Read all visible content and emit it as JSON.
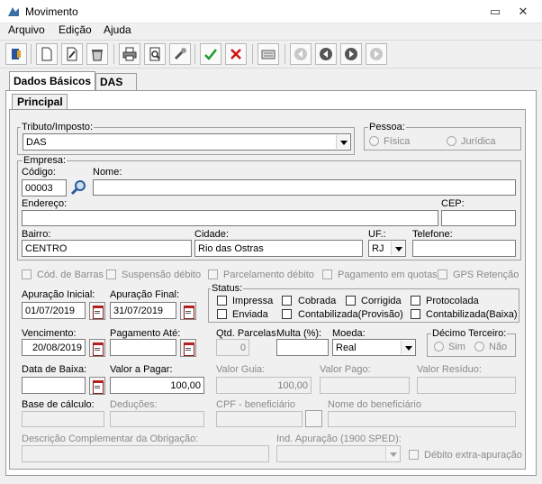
{
  "window": {
    "title": "Movimento"
  },
  "menu": [
    "Arquivo",
    "Edição",
    "Ajuda"
  ],
  "tabs": {
    "outer": [
      "Dados Básicos",
      "DAS"
    ],
    "inner": [
      "Principal"
    ]
  },
  "tributo": {
    "label": "Tributo/Imposto:",
    "value": "DAS"
  },
  "pessoa": {
    "label": "Pessoa:",
    "options": [
      "Física",
      "Jurídica"
    ]
  },
  "empresa": {
    "label": "Empresa:",
    "codigo_label": "Código:",
    "codigo": "00003",
    "nome_label": "Nome:",
    "nome": "",
    "endereco_label": "Endereço:",
    "endereco": "",
    "cep_label": "CEP:",
    "cep": "",
    "bairro_label": "Bairro:",
    "bairro": "CENTRO",
    "cidade_label": "Cidade:",
    "cidade": "Rio das Ostras",
    "uf_label": "UF.:",
    "uf": "RJ",
    "telefone_label": "Telefone:",
    "telefone": ""
  },
  "checks": [
    "Cód. de Barras",
    "Suspensão débito",
    "Parcelamento débito",
    "Pagamento em quotas",
    "GPS Retenção"
  ],
  "apuracao": {
    "inicial_label": "Apuração Inicial:",
    "inicial": "01/07/2019",
    "final_label": "Apuração Final:",
    "final": "31/07/2019"
  },
  "status": {
    "label": "Status:",
    "items": [
      "Impressa",
      "Cobrada",
      "Corrigida",
      "Protocolada",
      "Enviada",
      "Contabilizada(Provisão)",
      "Contabilizada(Baixa)"
    ]
  },
  "vencimento": {
    "label": "Vencimento:",
    "value": "20/08/2019"
  },
  "pagamento_ate": {
    "label": "Pagamento Até:",
    "value": ""
  },
  "qtd_parcelas": {
    "label": "Qtd. Parcelas",
    "value": "0"
  },
  "multa": {
    "label": "Multa (%):",
    "value": ""
  },
  "moeda": {
    "label": "Moeda:",
    "value": "Real"
  },
  "decimo": {
    "label": "Décimo Terceiro:",
    "options": [
      "Sim",
      "Não"
    ]
  },
  "data_baixa": {
    "label": "Data de Baixa:",
    "value": ""
  },
  "valor_pagar": {
    "label": "Valor a Pagar:",
    "value": "100,00"
  },
  "valor_guia": {
    "label": "Valor Guia:",
    "value": "100,00"
  },
  "valor_pago": {
    "label": "Valor Pago:",
    "value": ""
  },
  "valor_residuo": {
    "label": "Valor Resíduo:",
    "value": ""
  },
  "base_calculo": {
    "label": "Base de cálculo:",
    "value": ""
  },
  "deducoes": {
    "label": "Deduções:",
    "value": ""
  },
  "cpf": {
    "label": "CPF - beneficiário",
    "value": ""
  },
  "nome_beneficiario": {
    "label": "Nome do beneficiário",
    "value": ""
  },
  "descricao": {
    "label": "Descrição Complementar da Obrigação:",
    "value": ""
  },
  "ind_apuracao": {
    "label": "Ind. Apuração (1900 SPED):",
    "value": ""
  },
  "debito_extra": {
    "label": "Débito extra-apuração"
  }
}
